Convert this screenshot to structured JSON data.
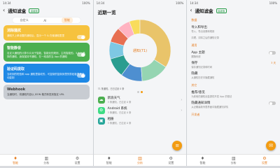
{
  "status": {
    "time": "14:34",
    "battery": "100%"
  },
  "screens": [
    {
      "title": "通知滤盒",
      "badge": "高级版",
      "segments": [
        "自定义",
        "AI",
        "智能"
      ],
      "active_segment": 2,
      "cards": [
        {
          "title": "消除骚扰",
          "desc": "通知只上单设置的通知后，显示一个 & 在使通知里里",
          "color": "#f6c23e",
          "toggle": true
        },
        {
          "title": "智能静音",
          "desc": "自定义通知的计算卡片对于智能，智能化的规则，主机智能的。3.5.5 选择的通知，适保保持不通知，在一段选的当 App 的通知",
          "color": "#4caf50",
          "toggle": true
        },
        {
          "title": "验证码提取",
          "desc": "当收到的短信和 app 通知里接收的，可复制的复制到里的剪贴板里是自动复制",
          "color": "#1e88e5",
          "toggle": true
        },
        {
          "title": "Webhook",
          "desc": "当通知时，将通知内容以 JSON 格式转发到指定 URL",
          "color": "#c8ccd2",
          "toggle": false,
          "dark": true
        }
      ],
      "nav": [
        "智能",
        "分析",
        "设置"
      ],
      "active_nav": 0
    },
    {
      "title": "近期一览",
      "donut_center": "通知(71)",
      "summary": "71 条通知，已已过滤 0 条",
      "items": [
        {
          "title": "新浪天气",
          "sub": "3 条通知，已过滤 0 条",
          "icon": "☁",
          "color": "#4caf50"
        },
        {
          "title": "Android 系统",
          "sub": "3 条通知，已过滤 0 条",
          "icon": "⚙",
          "color": "#3ddc84"
        },
        {
          "title": "相册",
          "sub": "3 条通知，已过滤 0 条",
          "icon": "▣",
          "color": "#26a69a"
        }
      ],
      "nav": [
        "智能",
        "分析",
        "设置"
      ],
      "active_nav": 1
    },
    {
      "title": "通知滤盒",
      "badge": "高级版",
      "sections": [
        {
          "name": "数据",
          "items": [
            {
              "title": "导入和导出",
              "sub": "导入、导出设置和规则"
            },
            {
              "title": "",
              "sub": "清理、清除之后的通知记录"
            }
          ]
        },
        {
          "name": "通用",
          "items": [
            {
              "title": "App 主题",
              "sub": "跟随系统",
              "control": "toggle"
            },
            {
              "title": "保存",
              "sub": "保存通知记录和时间",
              "right": "3 天"
            },
            {
              "title": "隐藏",
              "sub": "从通知历史中隐藏通知"
            }
          ]
        },
        {
          "name": "其它",
          "items": [
            {
              "title": "推荐/意见",
              "sub": "为其他的通知滤盒提供开发 App 的想法"
            },
            {
              "title": "隐藏通知详情",
              "sub": "从近期最新列表界面中隐藏通知详情",
              "control": "toggle"
            }
          ]
        },
        {
          "name": "开发者",
          "items": []
        }
      ],
      "nav": [
        "智能",
        "分析",
        "设置"
      ],
      "active_nav": 2
    }
  ],
  "chart_data": {
    "type": "pie",
    "title": "近期一览",
    "center_label": "通知(71)",
    "series": [
      {
        "value": 30,
        "color": "#e9c46a"
      },
      {
        "value": 13,
        "color": "#95d5b2"
      },
      {
        "value": 10,
        "color": "#4e8fd0"
      },
      {
        "value": 9,
        "color": "#2a9d8f"
      },
      {
        "value": 8,
        "color": "#7ec8e3"
      },
      {
        "value": 7,
        "color": "#e76f51"
      },
      {
        "value": 6,
        "color": "#ffb3c1"
      },
      {
        "value": 5,
        "color": "#f9dc5c"
      }
    ]
  },
  "icons": [
    "back-arrow-icon",
    "lightbulb-icon",
    "chart-icon",
    "gear-icon",
    "filter-icon",
    "chevron-right-icon"
  ]
}
